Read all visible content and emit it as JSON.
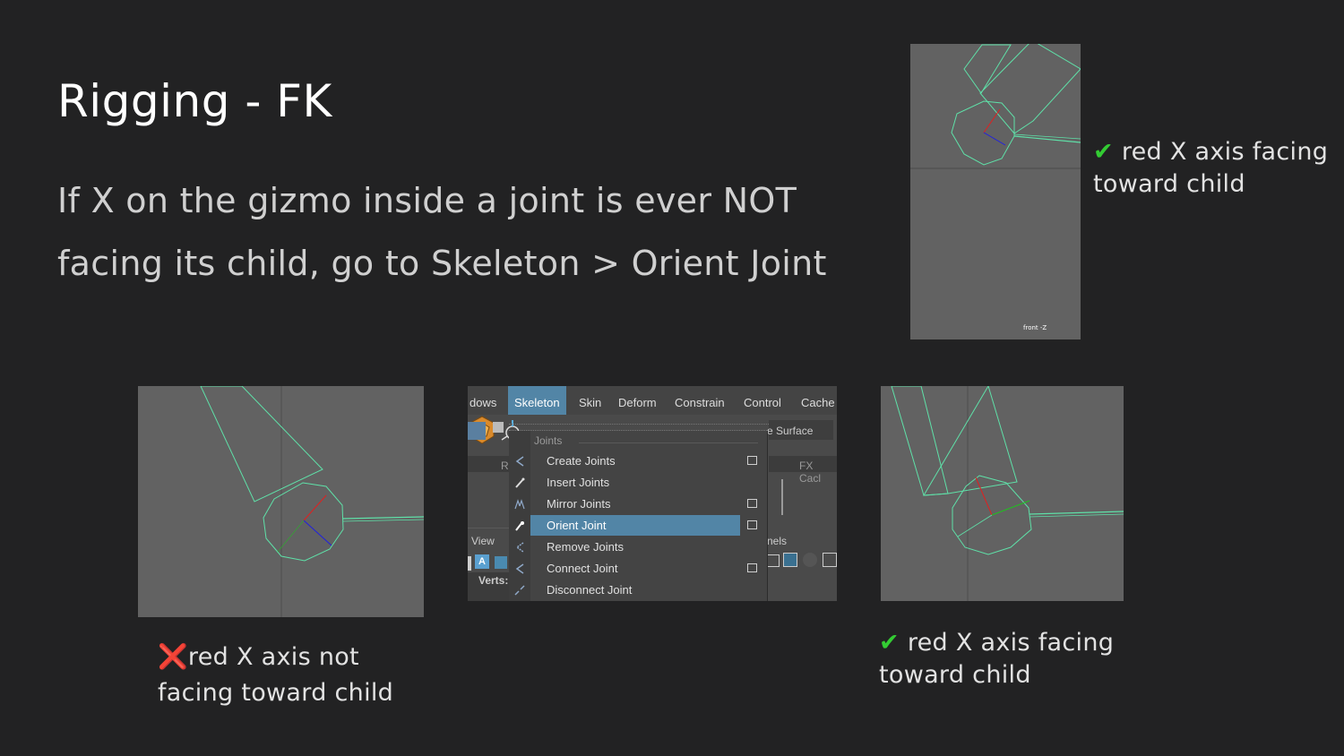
{
  "title": "Rigging - FK",
  "instructions": {
    "line1": "If X on the gizmo inside a joint is ever NOT",
    "line2": "facing its child, go to Skeleton > Orient Joint"
  },
  "captions": {
    "top_right": {
      "symbol": "✔",
      "line1": "red X axis facing",
      "line2": "toward child"
    },
    "bottom_left": {
      "symbol": "❌",
      "line1": "red X axis not",
      "line2": "facing toward child"
    },
    "bottom_right": {
      "symbol": "✔",
      "line1": "red X axis facing",
      "line2": "toward child"
    }
  },
  "viewport_top": {
    "camera_label": "front -Z"
  },
  "maya_menu": {
    "menubar": [
      "dows",
      "Skeleton",
      "Skin",
      "Deform",
      "Constrain",
      "Control",
      "Cache"
    ],
    "selected_menu": "Skeleton",
    "shelf_text": {
      "surface": "e Surface",
      "fx_cache": "FX Cacl",
      "view": "View",
      "panels": "nels",
      "verts": "Verts:",
      "r": "R"
    },
    "section_header": "Joints",
    "items": [
      {
        "label": "Create Joints",
        "option_box": true,
        "highlighted": false
      },
      {
        "label": "Insert Joints",
        "option_box": false,
        "highlighted": false
      },
      {
        "label": "Mirror Joints",
        "option_box": true,
        "highlighted": false
      },
      {
        "label": "Orient Joint",
        "option_box": true,
        "highlighted": true
      },
      {
        "label": "Remove Joints",
        "option_box": false,
        "highlighted": false
      },
      {
        "label": "Connect Joint",
        "option_box": true,
        "highlighted": false
      },
      {
        "label": "Disconnect Joint",
        "option_box": false,
        "highlighted": false
      }
    ]
  },
  "colors": {
    "background": "#222223",
    "viewport": "#626262",
    "joint_wire": "#5fe0a8",
    "x_axis": "#e02020",
    "y_axis": "#20c020",
    "z_axis": "#2020e0",
    "menu_highlight": "#5285a6",
    "check": "#33cc33",
    "cross": "#ee3333"
  }
}
